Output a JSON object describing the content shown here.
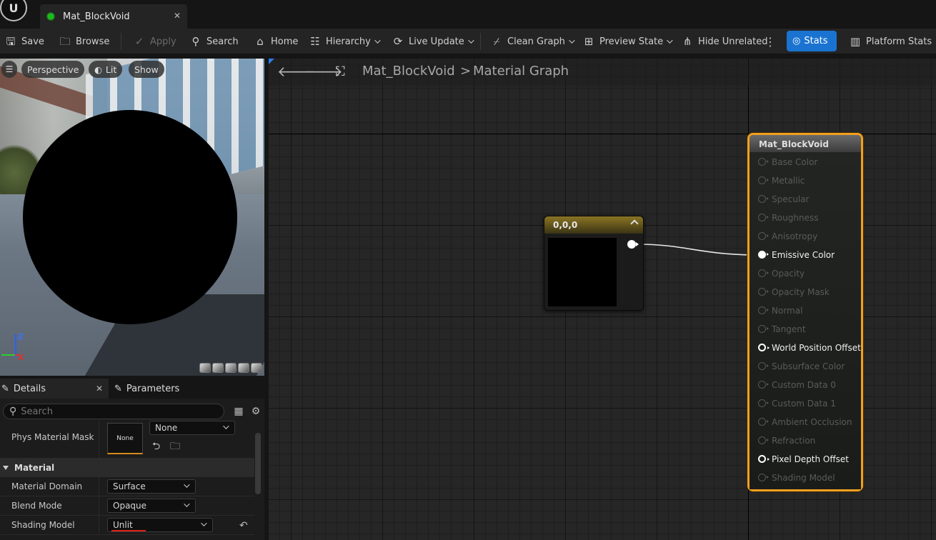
{
  "titlebar": {
    "tab_label": "Mat_BlockVoid",
    "close_glyph": "✕"
  },
  "toolbar": {
    "save": "Save",
    "browse": "Browse",
    "apply": "Apply",
    "search": "Search",
    "home": "Home",
    "hierarchy": "Hierarchy",
    "live_update": "Live Update",
    "clean_graph": "Clean Graph",
    "preview_state": "Preview State",
    "hide_unrelated": "Hide Unrelated",
    "stats": "Stats",
    "platform_stats": "Platform Stats"
  },
  "viewport": {
    "perspective": "Perspective",
    "lit": "Lit",
    "show": "Show",
    "axis_z": "Z",
    "axis_x": "X"
  },
  "details": {
    "details_tab": "Details",
    "parameters_tab": "Parameters",
    "search_placeholder": "Search",
    "phys_material_mask_label": "Phys Material Mask",
    "phys_material_mask_thumb": "None",
    "phys_material_mask_value": "None",
    "section_material": "Material",
    "material_domain_label": "Material Domain",
    "material_domain_value": "Surface",
    "blend_mode_label": "Blend Mode",
    "blend_mode_value": "Opaque",
    "shading_model_label": "Shading Model",
    "shading_model_value": "Unlit"
  },
  "graph": {
    "breadcrumb_asset": "Mat_BlockVoid",
    "breadcrumb_sep": ">",
    "breadcrumb_graph": "Material Graph",
    "constant_node_title": "0,0,0",
    "main_node_title": "Mat_BlockVoid",
    "pins": [
      {
        "label": "Base Color",
        "state": "inactive"
      },
      {
        "label": "Metallic",
        "state": "inactive"
      },
      {
        "label": "Specular",
        "state": "inactive"
      },
      {
        "label": "Roughness",
        "state": "inactive"
      },
      {
        "label": "Anisotropy",
        "state": "inactive"
      },
      {
        "label": "Emissive Color",
        "state": "connected"
      },
      {
        "label": "Opacity",
        "state": "inactive"
      },
      {
        "label": "Opacity Mask",
        "state": "inactive"
      },
      {
        "label": "Normal",
        "state": "inactive"
      },
      {
        "label": "Tangent",
        "state": "inactive"
      },
      {
        "label": "World Position Offset",
        "state": "active"
      },
      {
        "label": "Subsurface Color",
        "state": "inactive"
      },
      {
        "label": "Custom Data 0",
        "state": "inactive"
      },
      {
        "label": "Custom Data 1",
        "state": "inactive"
      },
      {
        "label": "Ambient Occlusion",
        "state": "inactive"
      },
      {
        "label": "Refraction",
        "state": "inactive"
      },
      {
        "label": "Pixel Depth Offset",
        "state": "active"
      },
      {
        "label": "Shading Model",
        "state": "inactive"
      }
    ]
  },
  "colors": {
    "accent_blue": "#1a73d1",
    "node_selected_border": "#f0a020",
    "constant_header": "#8a7424",
    "annotation_red": "#e0201a"
  }
}
